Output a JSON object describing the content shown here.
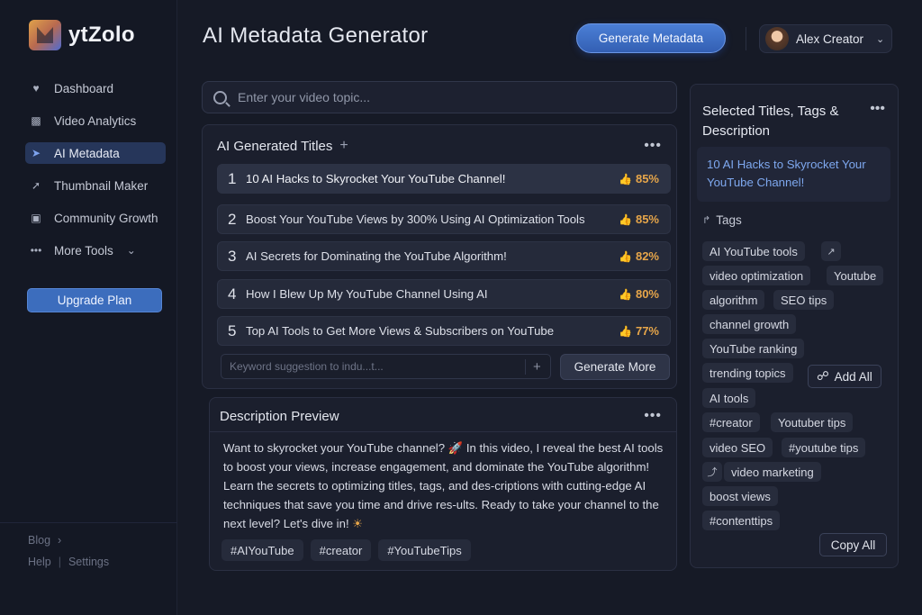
{
  "app": {
    "name": "ytZolo"
  },
  "sidebar": {
    "items": [
      {
        "label": "Dashboard",
        "icon": "heart-shield-icon",
        "active": false
      },
      {
        "label": "Video Analytics",
        "icon": "bar-chart-icon",
        "active": false
      },
      {
        "label": "AI Metadata",
        "icon": "paper-plane-icon",
        "active": true
      },
      {
        "label": "Thumbnail Maker",
        "icon": "rocket-icon",
        "active": false
      },
      {
        "label": "Community Growth",
        "icon": "monitor-icon",
        "active": false
      },
      {
        "label": "More Tools",
        "icon": "more-dots-icon",
        "active": false
      }
    ],
    "upgrade_label": "Upgrade Plan",
    "footer": {
      "blog": "Blog",
      "help": "Help",
      "settings": "Settings"
    }
  },
  "header": {
    "title": "AI Metadata Generator",
    "generate_label": "Generate Metadata",
    "user_name": "Alex Creator"
  },
  "search": {
    "placeholder": "Enter your video topic..."
  },
  "titles": {
    "heading": "AI Generated Titles",
    "items": [
      {
        "num": "1",
        "text": "10 AI Hacks to Skyrocket Your YouTube Channel!",
        "score": "85%"
      },
      {
        "num": "2",
        "text": "Boost Your YouTube Views by 300% Using AI Optimization Tools",
        "score": "85%"
      },
      {
        "num": "3",
        "text": "AI Secrets for Dominating the YouTube Algorithm!",
        "score": "82%"
      },
      {
        "num": "4",
        "text": "How I Blew Up My YouTube Channel Using AI",
        "score": "80%"
      },
      {
        "num": "5",
        "text": "Top AI Tools to Get More Views & Subscribers on YouTube",
        "score": "77%"
      }
    ],
    "keyword_placeholder": "Keyword suggestion to indu...t...",
    "generate_more_label": "Generate More"
  },
  "description": {
    "heading": "Description Preview",
    "text_before_emoji": "Want to skyrocket your YouTube channel? ",
    "emoji1": "🚀",
    "text_middle": " In this video, I reveal the best AI tools to boost your views, increase engagement, and dominate the YouTube algorithm!  Learn the secrets to optimizing titles, tags, and des-criptions with cutting-edge AI techniques that save you time and drive res-ults. Ready to take your channel to the next level? Let's dive in! ",
    "emoji2": "☀",
    "hashtags": [
      "#AIYouTube",
      "#creator",
      "#YouTubeTips"
    ]
  },
  "selected": {
    "heading": "Selected Titles, Tags & Description",
    "title": "10 AI Hacks to Skyrocket Your YouTube Channel!",
    "tags_label": "Tags",
    "tags": [
      "AI YouTube tools",
      "video optimization",
      "Youtube",
      "algorithm",
      "SEO tips",
      "channel growth",
      "YouTube ranking",
      "trending topics",
      "AI tools",
      "#creator",
      "Youtuber tips",
      "video SEO",
      "#youtube tips",
      "video marketing",
      "boost views",
      "#contenttips"
    ],
    "add_all_label": "Add All",
    "copy_all_label": "Copy All"
  }
}
